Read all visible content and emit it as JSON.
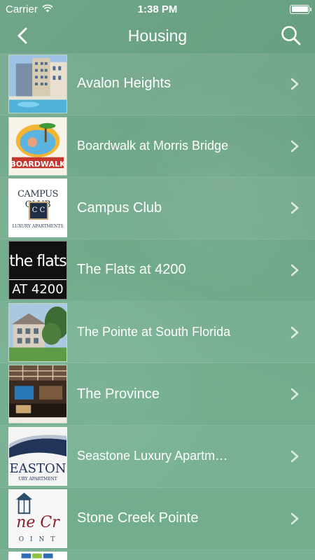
{
  "status": {
    "carrier": "Carrier",
    "time": "1:38 PM"
  },
  "nav": {
    "title": "Housing",
    "back_icon": "chevron-left-icon",
    "search_icon": "search-icon"
  },
  "listings": [
    {
      "name": "Avalon Heights"
    },
    {
      "name": "Boardwalk at Morris Bridge",
      "thumb_text": "BOARDWALK"
    },
    {
      "name": "Campus Club",
      "thumb_text": "CAMPUS CLUB",
      "thumb_sub": "LUXURY APARTMENTS",
      "thumb_mono": "C C"
    },
    {
      "name": "The Flats at 4200",
      "thumb_text": "the flats",
      "thumb_sub": "AT 4200"
    },
    {
      "name": "The Pointe at South Florida"
    },
    {
      "name": "The Province"
    },
    {
      "name": "Seastone Luxury Apartm…",
      "thumb_text": "EASTON",
      "thumb_sub": "URY APARTMENT"
    },
    {
      "name": "Stone Creek Pointe",
      "thumb_text": "ne Cr",
      "thumb_sub": "O I N T"
    }
  ],
  "colors": {
    "background": "#6daa8a",
    "text": "#ffffff"
  }
}
